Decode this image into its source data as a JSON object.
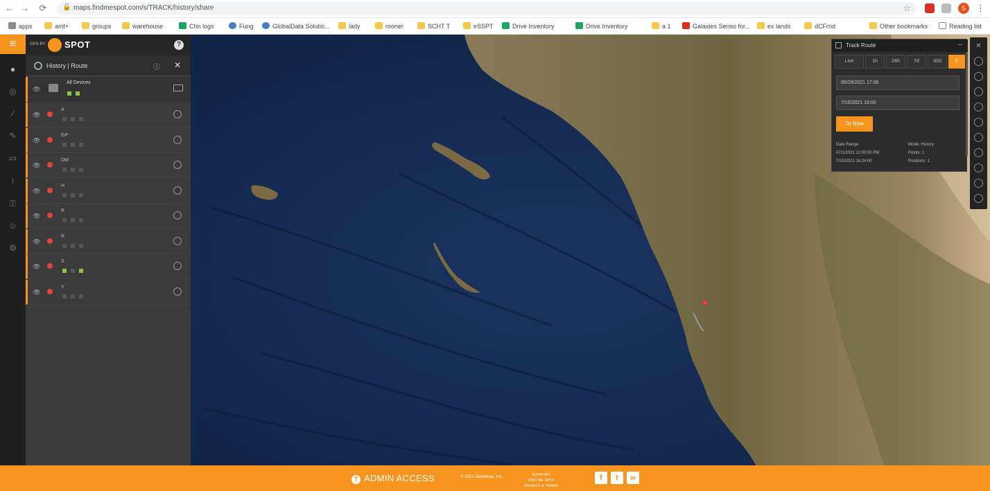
{
  "browser": {
    "url": "maps.findmespot.com/s/TRACK/history/share",
    "bookmarks": [
      {
        "label": "apps",
        "icon": "grid"
      },
      {
        "label": "amt+",
        "icon": "folder"
      },
      {
        "label": "groups",
        "icon": "folder"
      },
      {
        "label": "warehouse",
        "icon": "folder"
      },
      {
        "label": "Chn logs",
        "icon": "sheet"
      },
      {
        "label": "Fung",
        "icon": "globe"
      },
      {
        "label": "GlobalData Solutio...",
        "icon": "globe"
      },
      {
        "label": "lady",
        "icon": "folder"
      },
      {
        "label": "rooner",
        "icon": "folder"
      },
      {
        "label": "SCHT T",
        "icon": "folder"
      },
      {
        "label": "eSSPT",
        "icon": "folder"
      },
      {
        "label": "Drive Inventory",
        "icon": "sheet"
      },
      {
        "label": "Drive Inventory",
        "icon": "sheet"
      },
      {
        "label": "a 1",
        "icon": "folder"
      },
      {
        "label": "Galaxies Senso for...",
        "icon": "red"
      },
      {
        "label": "ex lands",
        "icon": "folder"
      },
      {
        "label": "dCFrnd",
        "icon": "folder"
      },
      {
        "label": "Other bookmarks",
        "icon": "folder"
      },
      {
        "label": "Reading list",
        "icon": "doc"
      }
    ]
  },
  "app": {
    "brand_small": "GPS BY",
    "brand_name": "SPOT",
    "panel_title": "History | Route",
    "group": {
      "name": "All Devices",
      "count": "8"
    },
    "devices": [
      {
        "name": "A",
        "active": false
      },
      {
        "name": "GP",
        "active": false
      },
      {
        "name": "DM",
        "active": false
      },
      {
        "name": "H",
        "active": false
      },
      {
        "name": "R",
        "active": false
      },
      {
        "name": "R",
        "active": false
      },
      {
        "name": "S",
        "active": true
      },
      {
        "name": "V",
        "active": false
      }
    ]
  },
  "track_panel": {
    "title": "Track Route",
    "tabs": [
      "Live",
      "1h",
      "24h",
      "7d",
      "30d",
      "C"
    ],
    "start": "06/29/2021 17:06",
    "end": "7/15/2021 16:00",
    "apply_label": "To Now",
    "meta_left": [
      "Date Range:",
      "07/1/2021 12:00:00 PM",
      "7/15/2021 16:24:00"
    ],
    "meta_right": [
      "Mode: History",
      "Points: 1",
      "Positions: 1"
    ]
  },
  "footer": {
    "access": "ADMIN ACCESS",
    "small_left": "© 2021 Globalstar, Inc.",
    "small_right_line1": "SUPPORT",
    "small_right_line2": "FIND ME SPOT",
    "small_right_line3": "PRIVACY & TERMS",
    "social": [
      "f",
      "t",
      "in"
    ]
  },
  "colors": {
    "accent": "#f7941d",
    "ocean": "#13284a",
    "land": "#7b6a44"
  }
}
